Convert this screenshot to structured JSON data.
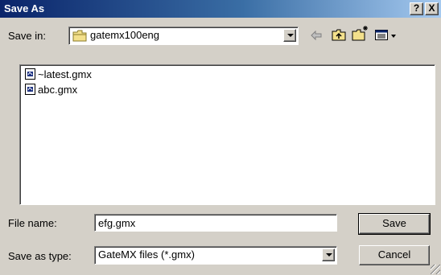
{
  "window": {
    "title": "Save As",
    "help_label": "?",
    "close_label": "X"
  },
  "save_in": {
    "label": "Save in:",
    "value": "gatemx100eng",
    "icon": "folder-icon"
  },
  "toolbar": {
    "back_icon": "back-arrow-icon",
    "up_icon": "up-one-level-icon",
    "new_folder_icon": "new-folder-icon",
    "view_icon": "view-menu-icon"
  },
  "files": [
    {
      "name": "~latest.gmx",
      "icon": "gmx-file-icon"
    },
    {
      "name": "abc.gmx",
      "icon": "gmx-file-icon"
    }
  ],
  "file_name": {
    "label": "File name:",
    "value": "efg.gmx"
  },
  "save_as_type": {
    "label": "Save as type:",
    "value": "GateMX files (*.gmx)"
  },
  "buttons": {
    "save": "Save",
    "cancel": "Cancel"
  },
  "colors": {
    "titlebar_start": "#0a246a",
    "titlebar_end": "#a6caf0",
    "face": "#d4d0c8"
  }
}
